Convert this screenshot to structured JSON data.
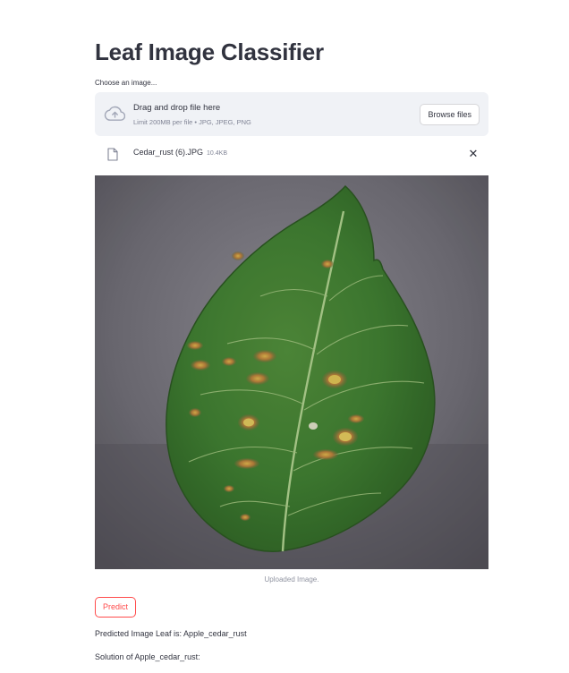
{
  "app": {
    "title": "Leaf Image Classifier"
  },
  "uploader": {
    "label": "Choose an image...",
    "drop_text": "Drag and drop file here",
    "limit_text": "Limit 200MB per file • JPG, JPEG, PNG",
    "browse_label": "Browse files",
    "icon": "cloud-upload-icon"
  },
  "uploaded_file": {
    "name": "Cedar_rust (6).JPG",
    "size": "10.4KB",
    "icon": "file-icon",
    "remove_icon": "close-icon",
    "remove_glyph": "✕"
  },
  "image": {
    "caption": "Uploaded Image."
  },
  "predict": {
    "label": "Predict",
    "accent": "#ff4b4b"
  },
  "result": {
    "prediction": "Predicted Image Leaf is: Apple_cedar_rust",
    "solution_heading": "Solution of Apple_cedar_rust:"
  }
}
